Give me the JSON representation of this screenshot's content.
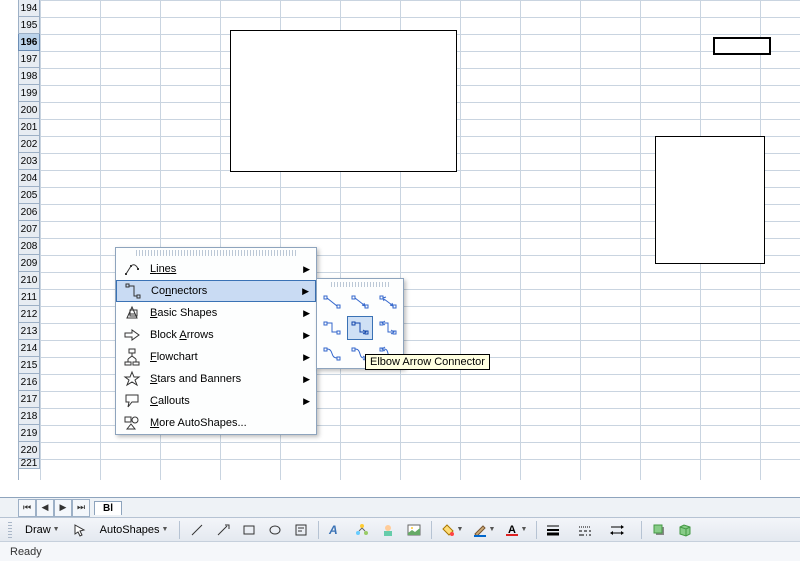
{
  "rows": [
    "194",
    "195",
    "196",
    "197",
    "198",
    "199",
    "200",
    "201",
    "202",
    "203",
    "204",
    "205",
    "206",
    "207",
    "208",
    "209",
    "210",
    "211",
    "212",
    "213",
    "214",
    "215",
    "216",
    "217",
    "218",
    "219",
    "220",
    "221"
  ],
  "selected_row": "196",
  "sheet_tab": "Bl",
  "status": "Ready",
  "drawbar": {
    "draw_label": "Draw",
    "autoshapes_label": "AutoShapes"
  },
  "menu": {
    "lines": "Lines",
    "connectors": "Connectors",
    "basic_shapes": "Basic Shapes",
    "block_arrows": "Block Arrows",
    "flowchart": "Flowchart",
    "stars": "Stars and Banners",
    "callouts": "Callouts",
    "more": "More AutoShapes..."
  },
  "tooltip": "Elbow Arrow Connector",
  "connectors_palette": [
    "straight-connector",
    "straight-arrow-connector",
    "straight-double-arrow-connector",
    "elbow-connector",
    "elbow-arrow-connector",
    "elbow-double-arrow-connector",
    "curved-connector",
    "curved-arrow-connector",
    "curved-double-arrow-connector"
  ]
}
